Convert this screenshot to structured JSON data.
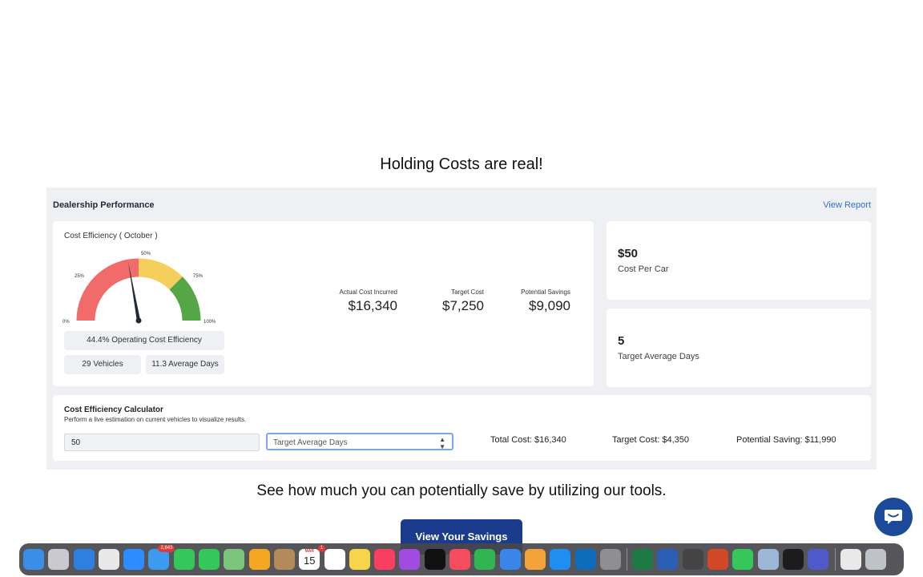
{
  "headline": "Holding Costs are real!",
  "panel": {
    "title": "Dealership Performance",
    "view_report": "View Report"
  },
  "efficiency": {
    "title": "Cost Efficiency ( October )",
    "gauge": {
      "value_percent": 44.4,
      "labels": [
        "0%",
        "25%",
        "50%",
        "75%",
        "100%"
      ],
      "colors": {
        "red": "#f16b6b",
        "yellow": "#f5cf5c",
        "green": "#55a644"
      }
    },
    "operating_efficiency": "44.4% Operating Cost Efficiency",
    "vehicles": "29 Vehicles",
    "average_days": "11.3 Average Days",
    "actual_cost_label": "Actual Cost Incurred",
    "actual_cost_value": "$16,340",
    "target_cost_label": "Target Cost",
    "target_cost_value": "$7,250",
    "potential_savings_label": "Potential Savings",
    "potential_savings_value": "$9,090"
  },
  "side_cards": {
    "cost_per_car_value": "$50",
    "cost_per_car_label": "Cost Per Car",
    "target_days_value": "5",
    "target_days_label": "Target Average Days"
  },
  "calculator": {
    "title": "Cost Efficiency Calculator",
    "subtitle": "Perform a live estimation on current vehicles to visualize results.",
    "input_value": "50",
    "select_value": "Target Average Days",
    "total_cost": "Total Cost: $16,340",
    "target_cost": "Target Cost: $4,350",
    "potential_saving": "Potential Saving: $11,990"
  },
  "tagline": "See how much you can potentially save by utilizing our tools.",
  "cta_label": "View Your Savings",
  "dock": {
    "mail_badge": "2,643",
    "calendar_month": "MAR",
    "calendar_day": "15",
    "calendar_badge": "1",
    "apps": [
      {
        "name": "finder-icon",
        "color": "#3a8ee6"
      },
      {
        "name": "launchpad-icon",
        "color": "#c9c9cf"
      },
      {
        "name": "safari-icon",
        "color": "#2f7fe0"
      },
      {
        "name": "chrome-icon",
        "color": "#e8e8e8"
      },
      {
        "name": "zoom-icon",
        "color": "#2d8cff"
      },
      {
        "name": "mail-icon",
        "color": "#3b9bf1"
      },
      {
        "name": "facetime-icon",
        "color": "#34c759"
      },
      {
        "name": "messages-icon",
        "color": "#34c759"
      },
      {
        "name": "maps-icon",
        "color": "#7bc67b"
      },
      {
        "name": "photos-icon",
        "color": "#f5a623"
      },
      {
        "name": "contacts-icon",
        "color": "#b58a5a"
      },
      {
        "name": "calendar-icon",
        "color": "#ffffff"
      },
      {
        "name": "reminders-icon",
        "color": "#ffffff"
      },
      {
        "name": "notes-icon",
        "color": "#f7d54a"
      },
      {
        "name": "music-icon",
        "color": "#fa3e5f"
      },
      {
        "name": "podcasts-icon",
        "color": "#a24be0"
      },
      {
        "name": "tv-icon",
        "color": "#111111"
      },
      {
        "name": "news-icon",
        "color": "#f74c5d"
      },
      {
        "name": "numbers-icon",
        "color": "#31b552"
      },
      {
        "name": "keynote-icon",
        "color": "#3a86e8"
      },
      {
        "name": "pages-icon",
        "color": "#f3a33a"
      },
      {
        "name": "app-store-icon",
        "color": "#1e8ef2"
      },
      {
        "name": "outlook-icon",
        "color": "#0f6cbd"
      },
      {
        "name": "system-settings-icon",
        "color": "#8e8e93"
      },
      {
        "name": "excel-icon",
        "color": "#1e7a45"
      },
      {
        "name": "word-icon",
        "color": "#2b5fb4"
      },
      {
        "name": "instruments-icon",
        "color": "#444444"
      },
      {
        "name": "powerpoint-icon",
        "color": "#d24726"
      },
      {
        "name": "battery-icon",
        "color": "#35c759"
      },
      {
        "name": "preview-icon",
        "color": "#9fb7d6"
      },
      {
        "name": "terminal-icon",
        "color": "#1c1c1c"
      },
      {
        "name": "teams-icon",
        "color": "#5059c9"
      },
      {
        "name": "documents-icon",
        "color": "#e9e9e9"
      },
      {
        "name": "trash-icon",
        "color": "#bfc3c8"
      }
    ]
  }
}
